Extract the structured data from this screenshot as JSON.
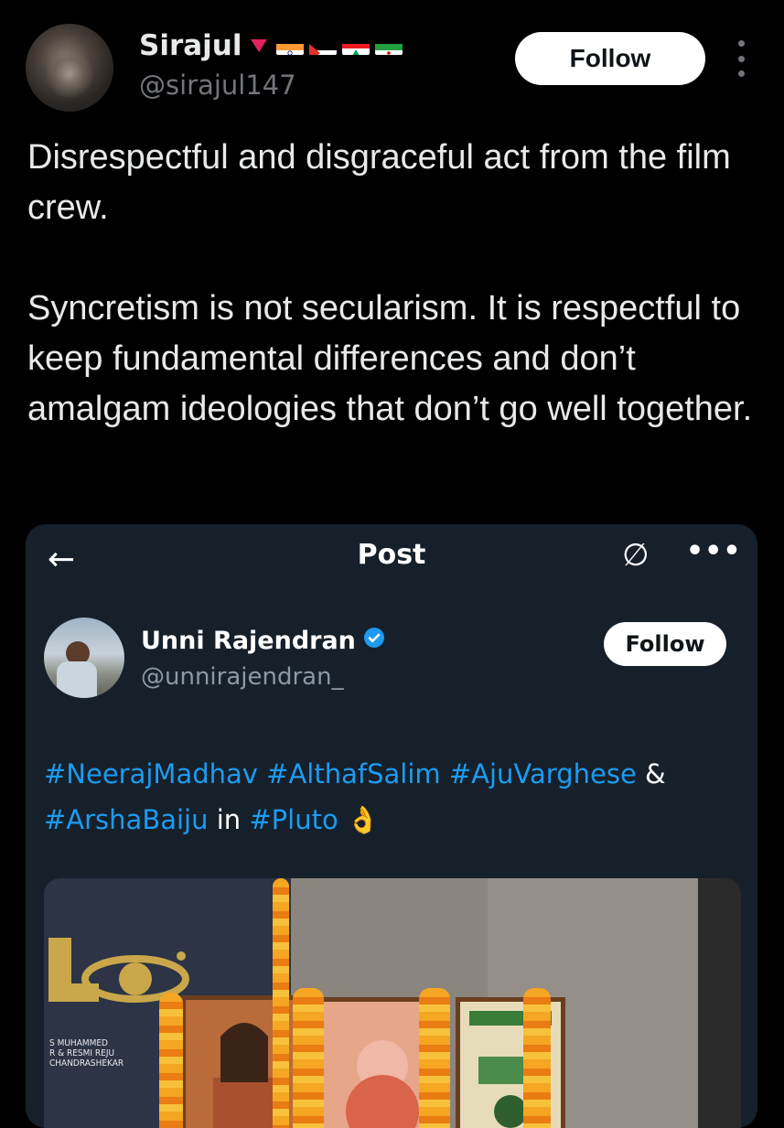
{
  "post": {
    "author_name": "Sirajul",
    "author_handle": "@sirajul147",
    "follow_label": "Follow",
    "paragraphs": [
      "Disrespectful and disgraceful act from the film crew.",
      "Syncretism is not secularism. It is respectful to keep fundamental differences and don’t amalgam ideologies that don’t go well together."
    ]
  },
  "quoted": {
    "back_icon": "←",
    "title": "Post",
    "grok_icon": "∅",
    "more_icon": "•••",
    "author_name": "Unni Rajendran",
    "author_handle": "@unnirajendran_",
    "follow_label": "Follow",
    "text": {
      "tag1": "#NeerajMadhav",
      "tag2": "#AlthafSalim",
      "tag3": "#AjuVarghese",
      "amp": "&",
      "tag4": "#ArshaBaiju",
      "in": "in",
      "tag5": "#Pluto",
      "emoji": "👌"
    },
    "media": {
      "credits_line1": "S MUHAMMED",
      "credits_line2": "R & RESMI REJU",
      "credits_line3": "CHANDRASHEKAR"
    }
  },
  "colors": {
    "background": "#000000",
    "link": "#1d9bf0",
    "verified": "#1d9bf0",
    "quote_bg": "#15202b"
  },
  "icons": [
    "more-vertical-icon",
    "back-arrow-icon",
    "grok-icon",
    "more-horizontal-icon",
    "verified-badge-icon",
    "flag-india-icon",
    "flag-palestine-icon",
    "flag-lebanon-icon",
    "flag-iran-icon"
  ]
}
